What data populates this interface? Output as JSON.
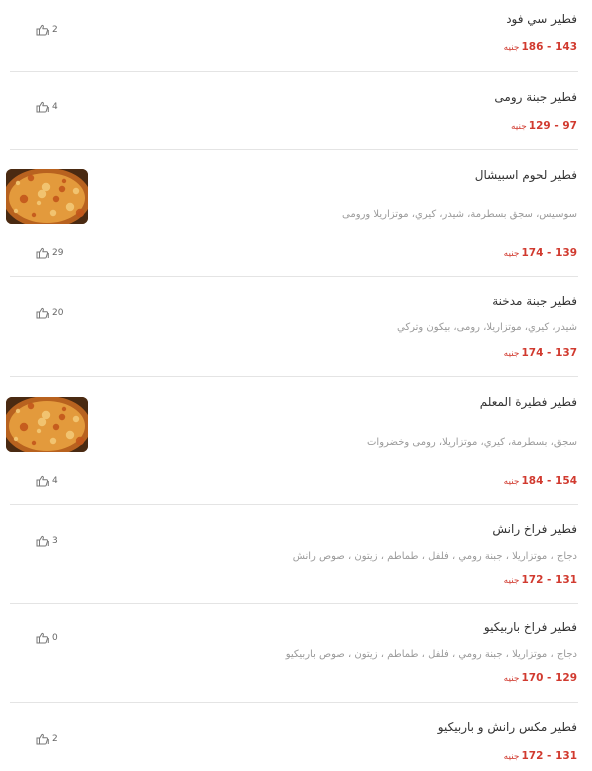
{
  "items": [
    {
      "name": "فطير سي فود",
      "desc": "",
      "price": "143 - 186",
      "currency": "جنيه",
      "likes": "2",
      "image": ""
    },
    {
      "name": "فطير جبنة رومى",
      "desc": "",
      "price": "97 - 129",
      "currency": "جنيه",
      "likes": "4",
      "image": ""
    },
    {
      "name": "فطير لحوم اسبيشال",
      "desc": "سوسيس، سجق بسطرمة، شيدر، كيري، موتزاريلا ورومى",
      "price": "139 - 174",
      "currency": "جنيه",
      "likes": "29",
      "image": "pizza-photo"
    },
    {
      "name": "فطير جبنة مدخنة",
      "desc": "شيدر، كيري، موتزاريلا، رومى، بيكون وتركي",
      "price": "137 - 174",
      "currency": "جنيه",
      "likes": "20",
      "image": ""
    },
    {
      "name": "فطير فطيرة المعلم",
      "desc": "سجق، بسطرمة، كيري، موتزاريلا، رومى وخضروات",
      "price": "154 - 184",
      "currency": "جنيه",
      "likes": "4",
      "image": "pizza-photo"
    },
    {
      "name": "فطير فراخ رانش",
      "desc": "دجاج ، موتزاريلا ، جبنة رومي ، فلفل ، طماطم ، زيتون ، صوص رانش",
      "price": "131 - 172",
      "currency": "جنيه",
      "likes": "3",
      "image": ""
    },
    {
      "name": "فطير فراخ باربيكيو",
      "desc": "دجاج ، موتزاريلا ، جبنة رومي ، فلفل ، طماطم ، زيتون ، صوص باربيكيو",
      "price": "129 - 170",
      "currency": "جنيه",
      "likes": "0",
      "image": ""
    },
    {
      "name": "فطير مكس رانش و باربيكيو",
      "desc": "",
      "price": "131 - 172",
      "currency": "جنيه",
      "likes": "2",
      "image": ""
    }
  ],
  "colors": {
    "price": "#d13a2f",
    "name": "#333333",
    "desc": "#9a9a9a",
    "divider": "#e4e4e4"
  },
  "icons": {
    "like": "thumbs-up-icon"
  }
}
